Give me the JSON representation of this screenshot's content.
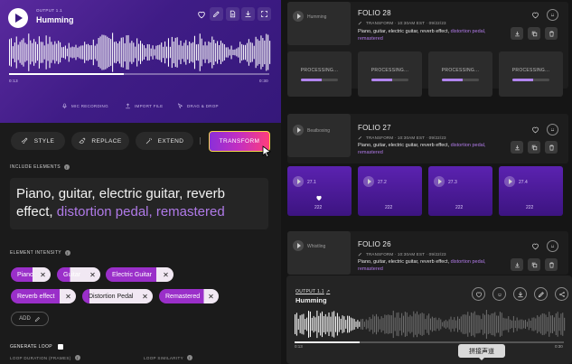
{
  "player": {
    "output_label": "OUTPUT 1.1",
    "title": "Humming",
    "time_start": "0:13",
    "time_end": "0:30",
    "progress": 0.44,
    "actions": [
      "MIC RECORDING",
      "IMPORT FILE",
      "DRAG & DROP"
    ]
  },
  "modes": {
    "style": "STYLE",
    "replace": "REPLACE",
    "extend": "EXTEND",
    "transform": "TRANSFORM"
  },
  "include_elements": {
    "label": "INCLUDE ELEMENTS",
    "prompt_plain": "Piano, guitar, electric guitar, reverb effect, ",
    "prompt_highlight": "distortion pedal, remastered"
  },
  "element_intensity": {
    "label": "ELEMENT INTENSITY",
    "chips": [
      {
        "label": "Piano",
        "level": 0.55
      },
      {
        "label": "Guitar",
        "level": 0.3
      },
      {
        "label": "Electric Guitar",
        "level": 0.75
      },
      {
        "label": "Reverb effect",
        "level": 0.75
      },
      {
        "label": "Distortion Pedal",
        "level": 0.1
      },
      {
        "label": "Remastered",
        "level": 0.75
      }
    ],
    "add_label": "ADD"
  },
  "loop": {
    "generate_label": "GENERATE LOOP",
    "duration_label": "LOOP DURATION (FRAMES)",
    "similarity_label": "LOOP SIMILARITY"
  },
  "folios": [
    {
      "thumb_label": "Humming",
      "title": "FOLIO 28",
      "meta": "TRANSFORM · 10:30AM EST · 09/22/23",
      "desc_plain": "Piano, guitar, electric guitar, reverb effect, ",
      "desc_highlight1": "distortion pedal,",
      "desc_highlight2": "remastered"
    },
    {
      "thumb_label": "Beatboxing",
      "title": "FOLIO 27",
      "meta": "TRANSFORM · 10:30AM EST · 09/22/23",
      "desc_plain": "Piano, guitar, electric guitar, reverb effect, ",
      "desc_highlight1": "distortion pedal,",
      "desc_highlight2": "remastered"
    },
    {
      "thumb_label": "Whistling",
      "title": "FOLIO 26",
      "meta": "TRANSFORM · 10:30AM EST · 09/22/23",
      "desc_plain": "Piano, guitar, electric guitar, reverb effect, ",
      "desc_highlight1": "distortion pedal,",
      "desc_highlight2": "remastered"
    }
  ],
  "processing": {
    "text": "PROCESSING...",
    "progress": [
      0.55,
      0.55,
      0.55,
      0.55
    ]
  },
  "variations": [
    "27.1",
    "27.2",
    "27.3",
    "27.4"
  ],
  "variation_badge": "222",
  "bottom_player": {
    "output_label": "OUTPUT 1.1",
    "title": "Humming",
    "time_start": "0:13",
    "time_end": "0:30",
    "progress": 0.24
  },
  "tooltip": "拼接声道"
}
